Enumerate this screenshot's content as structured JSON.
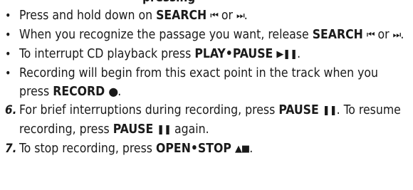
{
  "heading_fragment": "pressing",
  "items": [
    {
      "marker": "•",
      "segments": [
        {
          "text": "Press and hold down on ",
          "style": "plain"
        },
        {
          "text": "SEARCH",
          "style": "kw"
        },
        {
          "text": " ",
          "style": "plain"
        },
        {
          "text": "⏮",
          "style": "sym"
        },
        {
          "text": " or ",
          "style": "plain"
        },
        {
          "text": "⏭",
          "style": "sym"
        },
        {
          "text": ".",
          "style": "plain"
        }
      ]
    },
    {
      "marker": "•",
      "segments": [
        {
          "text": "When you recognize the passage you want, release ",
          "style": "plain"
        },
        {
          "text": "SEARCH",
          "style": "kw"
        },
        {
          "text": " ",
          "style": "plain"
        },
        {
          "text": "⏮",
          "style": "sym"
        },
        {
          "text": " or ",
          "style": "plain"
        },
        {
          "text": "⏭",
          "style": "sym"
        },
        {
          "text": ".",
          "style": "plain"
        }
      ]
    },
    {
      "marker": "•",
      "segments": [
        {
          "text": "To interrupt CD playback press ",
          "style": "plain"
        },
        {
          "text": "PLAY•PAUSE",
          "style": "kw"
        },
        {
          "text": " ",
          "style": "plain"
        },
        {
          "text": "▶❚❚",
          "style": "sym-bold"
        },
        {
          "text": ".",
          "style": "plain"
        }
      ]
    },
    {
      "marker": "•",
      "segments": [
        {
          "text": "Recording will begin from this exact point in the track when you press ",
          "style": "plain"
        },
        {
          "text": "RECORD",
          "style": "kw"
        },
        {
          "text": " ",
          "style": "plain"
        },
        {
          "text": "●",
          "style": "sym-rec"
        },
        {
          "text": ".",
          "style": "plain"
        }
      ]
    },
    {
      "marker": "6.",
      "segments": [
        {
          "text": "For brief interruptions during recording, press ",
          "style": "plain"
        },
        {
          "text": "PAUSE",
          "style": "kw"
        },
        {
          "text": " ",
          "style": "plain"
        },
        {
          "text": "❚❚",
          "style": "sym-bold"
        },
        {
          "text": ". To resume recording, press ",
          "style": "plain"
        },
        {
          "text": "PAUSE",
          "style": "kw"
        },
        {
          "text": " ",
          "style": "plain"
        },
        {
          "text": "❚❚",
          "style": "sym-bold"
        },
        {
          "text": " again.",
          "style": "plain"
        }
      ]
    },
    {
      "marker": "7.",
      "segments": [
        {
          "text": "To stop recording, press ",
          "style": "plain"
        },
        {
          "text": "OPEN•STOP",
          "style": "kw"
        },
        {
          "text": " ",
          "style": "plain"
        },
        {
          "text": "▲■",
          "style": "sym-bold"
        },
        {
          "text": ".",
          "style": "plain"
        }
      ]
    }
  ]
}
